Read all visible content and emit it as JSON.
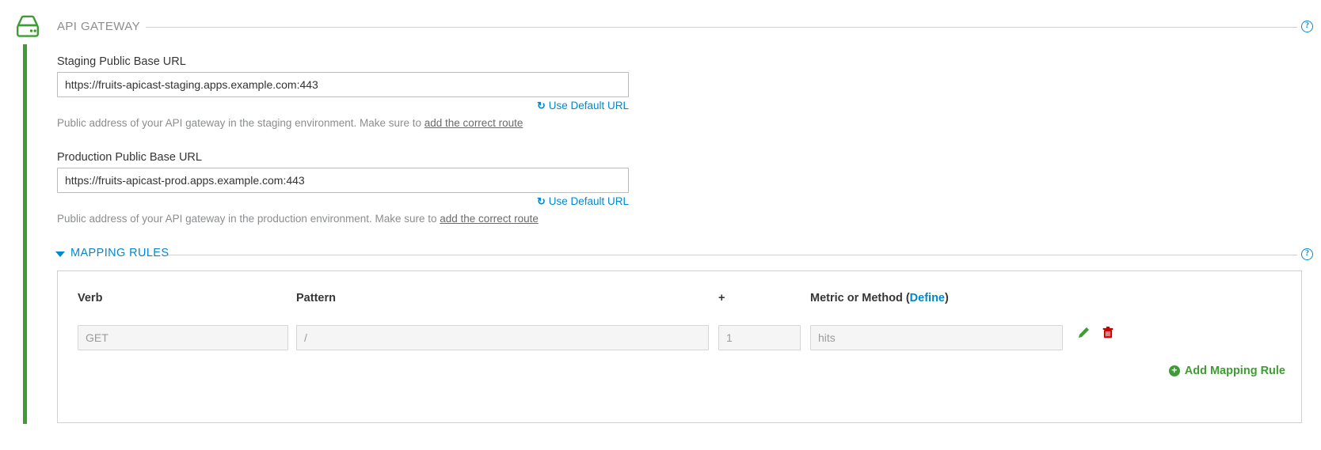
{
  "section": {
    "title": "API GATEWAY",
    "icon": "server-icon",
    "help_label": "?"
  },
  "staging": {
    "label": "Staging Public Base URL",
    "value": "https://fruits-apicast-staging.apps.example.com:443",
    "use_default_label": "Use Default URL",
    "reset_icon": "↺",
    "help_prefix": "Public address of your API gateway in the staging environment. Make sure to ",
    "help_link": "add the correct route"
  },
  "production": {
    "label": "Production Public Base URL",
    "value": "https://fruits-apicast-prod.apps.example.com:443",
    "use_default_label": "Use Default URL",
    "reset_icon": "↺",
    "help_prefix": "Public address of your API gateway in the production environment. Make sure to ",
    "help_link": "add the correct route"
  },
  "mapping_rules": {
    "section_title": "MAPPING RULES",
    "help_label": "?",
    "columns": {
      "verb": "Verb",
      "pattern": "Pattern",
      "increment": "+",
      "metric_prefix": "Metric or Method (",
      "metric_link": "Define",
      "metric_suffix": ")"
    },
    "rows": [
      {
        "verb_placeholder": "GET",
        "pattern_placeholder": "/",
        "increment_placeholder": "1",
        "metric_placeholder": "hits",
        "edit_icon": "pencil-icon",
        "delete_icon": "trash-icon"
      }
    ],
    "add_rule_label": "Add Mapping Rule",
    "add_rule_icon": "+"
  },
  "colors": {
    "brand_green": "#3f9c35",
    "link_blue": "#0088ce",
    "muted_gray": "#8b8d8f",
    "danger_red": "#cc0000"
  }
}
